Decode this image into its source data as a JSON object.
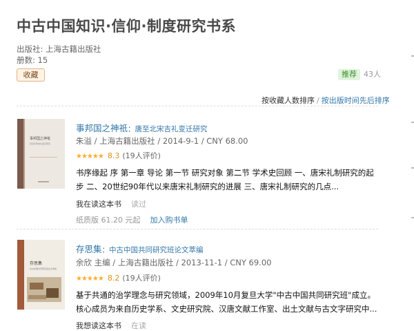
{
  "page": {
    "title": "中古中国知识·信仰·制度研究书系",
    "publisher_line": "出版社: 上海古籍出版社",
    "count_line": "册数:  15"
  },
  "actions": {
    "collect_label": "收藏",
    "recommend_label": "推荐",
    "recommend_count": "43人"
  },
  "sort": {
    "by_collectors": "按收藏人数排序",
    "separator": "/",
    "by_date": "按出版时间先后排序"
  },
  "books": [
    {
      "title": "事邦国之神祇",
      "subtitle": "：唐至北宋吉礼变迁研究",
      "pub_info": "朱溢 / 上海古籍出版社 / 2014-9-1 / CNY 68.00",
      "stars": "★★★★★",
      "score": "8.3",
      "votes": "(19人评价)",
      "desc": "书序缘起 序 第一章 导论 第一节 研究对象 第二节 学术史回顾 一、唐宋礼制研究的起步 二、20世纪90年代以来唐宋礼制研究的进展 三、唐宋礼制研究的几点...",
      "status_reading": "我在读这本书",
      "status_read": "读过",
      "paper_price": "纸质版 61.20 元起",
      "cart_label": "加入购书单",
      "cover": {
        "bg": "#f1ede6",
        "spine": "#7a5a4c",
        "title": "事邦国之神祇",
        "line": "唐至北宋吉礼变迁研究"
      }
    },
    {
      "title": "存思集",
      "subtitle": "：中古中国共同研究班论文萃编",
      "pub_info": "余欣 主编 / 上海古籍出版社 / 2013-11-1 / CNY 69.00",
      "stars": "★★★★★",
      "score": "8.2",
      "votes": "(19人评价)",
      "desc": "基于共通的治学理念与研究领域，2009年10月复旦大学\"中古中国共同研究班\"成立。核心成员为来自历史学系、文史研究院、汉唐文献工作室、出土文献与古文字研究中...",
      "status_reading": "我想读这本书",
      "status_read": "在读",
      "cover": {
        "bg": "#f3efe8",
        "spine": "#a25a3c",
        "title": "存思集",
        "line": "中古中国共同研究班论文萃编"
      }
    }
  ]
}
